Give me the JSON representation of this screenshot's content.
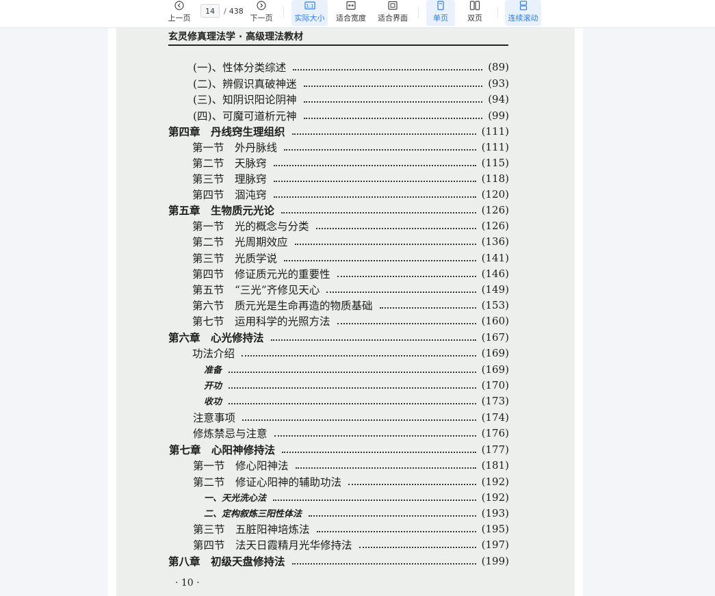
{
  "toolbar": {
    "prev_label": "上一页",
    "next_label": "下一页",
    "current_page": "14",
    "page_separator": "/",
    "total_pages": "438",
    "actual_size_label": "实际大小",
    "fit_width_label": "适合宽度",
    "fit_page_label": "适合界面",
    "single_page_label": "单页",
    "double_page_label": "双页",
    "continuous_label": "连续滚动",
    "accent_color": "#2f7de1"
  },
  "document": {
    "header": "玄灵修真理法学 · 高级理法教材",
    "page_number": "· 10 ·",
    "toc": [
      {
        "text": "(一)、性体分类综述",
        "page": "(89)"
      },
      {
        "text": "(二)、辨假识真破神迷",
        "page": "(93)"
      },
      {
        "text": "(三)、知阴识阳论阴神",
        "page": "(94)"
      },
      {
        "text": "(四)、可魔可道析元神",
        "page": "(99)"
      },
      {
        "text": "第四章　丹线窍生理组织",
        "page": "(111)"
      },
      {
        "text": "第一节　外丹脉线",
        "page": "(111)"
      },
      {
        "text": "第二节　天脉窍",
        "page": "(115)"
      },
      {
        "text": "第三节　理脉窍",
        "page": "(118)"
      },
      {
        "text": "第四节　涸沌窍",
        "page": "(120)"
      },
      {
        "text": "第五章　生物质元光论",
        "page": "(126)"
      },
      {
        "text": "第一节　光的概念与分类",
        "page": "(126)"
      },
      {
        "text": "第二节　光周期效应",
        "page": "(136)"
      },
      {
        "text": "第三节　光质学说",
        "page": "(141)"
      },
      {
        "text": "第四节　修证质元光的重要性",
        "page": "(146)"
      },
      {
        "text": "第五节　“三光”齐修见天心",
        "page": "(149)"
      },
      {
        "text": "第六节　质元光是生命再造的物质基础",
        "page": "(153)"
      },
      {
        "text": "第七节　运用科学的光照方法",
        "page": "(160)"
      },
      {
        "text": "第六章　心光修持法",
        "page": "(167)"
      },
      {
        "text": "功法介绍",
        "page": "(169)"
      },
      {
        "text": "准备",
        "page": "(169)"
      },
      {
        "text": "开功",
        "page": "(170)"
      },
      {
        "text": "收功",
        "page": "(173)"
      },
      {
        "text": "注意事项",
        "page": "(174)"
      },
      {
        "text": "修炼禁忌与注意",
        "page": "(176)"
      },
      {
        "text": "第七章　心阳神修持法",
        "page": "(177)"
      },
      {
        "text": "第一节　修心阳神法",
        "page": "(181)"
      },
      {
        "text": "第二节　修证心阳神的辅助功法",
        "page": "(192)"
      },
      {
        "text": "一、天光洗心法",
        "page": "(192)"
      },
      {
        "text": "二、定构叙炼三阳性体法",
        "page": "(193)"
      },
      {
        "text": "第三节　五脏阳神培炼法",
        "page": "(195)"
      },
      {
        "text": "第四节　法天日霞精月光华修持法",
        "page": "(197)"
      },
      {
        "text": "第八章　初级天盘修持法",
        "page": "(199)"
      }
    ]
  }
}
